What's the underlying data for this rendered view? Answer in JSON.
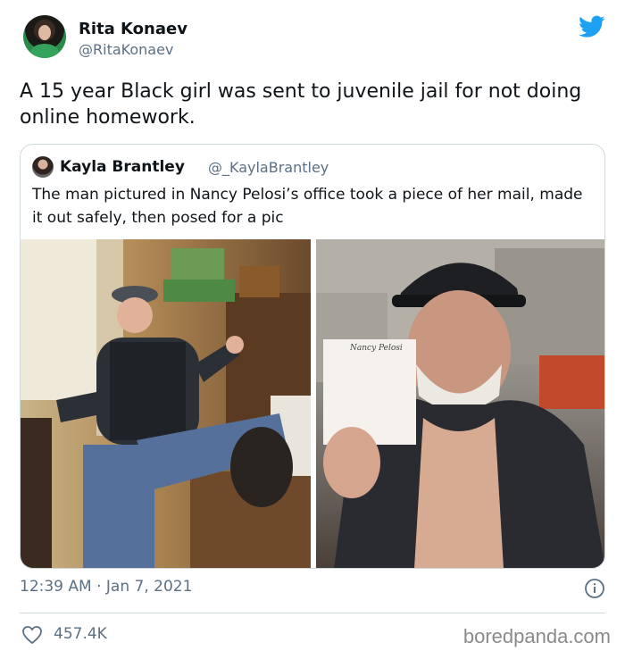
{
  "tweet": {
    "author_name": "Rita Konaev",
    "author_handle": "@RitaKonaev",
    "text": "A 15 year Black girl was sent to juvenile jail for not doing online homework.",
    "timestamp": "12:39 AM · Jan 7, 2021",
    "likes": "457.4K"
  },
  "quoted_tweet": {
    "author_name": "Kayla Brantley",
    "author_handle": "@_KaylaBrantley",
    "text": "The man pictured in Nancy Pelosi’s office took a piece of her mail, made it out safely, then posed for a pic",
    "photos": [
      {
        "note_text": ""
      },
      {
        "note_text": "Nancy Pelosi"
      }
    ]
  },
  "watermark": "boredpanda.com",
  "colors": {
    "twitter_blue": "#1da1f2",
    "secondary_text": "#5b7083",
    "border": "#cfd9de"
  },
  "icons": [
    "twitter-bird-icon",
    "info-icon",
    "heart-icon"
  ]
}
